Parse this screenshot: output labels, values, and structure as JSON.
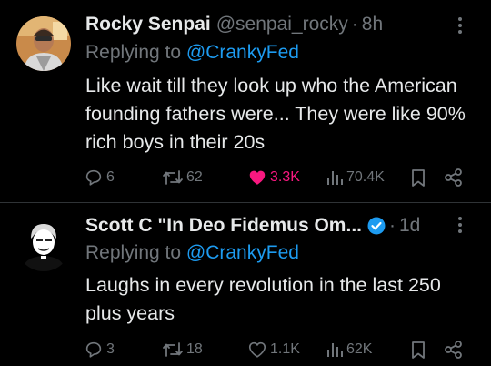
{
  "tweets": [
    {
      "name": "Rocky Senpai",
      "handle": "@senpai_rocky",
      "separator": "·",
      "time": "8h",
      "replying_prefix": "Replying to",
      "replying_to": "@CrankyFed",
      "text": "Like wait till they look up who the American founding fathers were... They were like 90% rich boys in their 20s",
      "replies": "6",
      "retweets": "62",
      "likes": "3.3K",
      "views": "70.4K",
      "liked": true
    },
    {
      "name": "Scott C \"In Deo Fidemus Om...",
      "handle": "",
      "separator": "·",
      "time": "1d",
      "replying_prefix": "Replying to",
      "replying_to": "@CrankyFed",
      "text": "Laughs in every revolution in the last 250 plus years",
      "replies": "3",
      "retweets": "18",
      "likes": "1.1K",
      "views": "62K",
      "liked": false,
      "verified": true
    }
  ],
  "colors": {
    "background": "#000000",
    "text": "#e7e9ea",
    "muted": "#71767b",
    "link": "#1d9bf0",
    "like_active": "#f91880",
    "divider": "#2f3336"
  },
  "icons": [
    "more-icon",
    "reply-icon",
    "retweet-icon",
    "heart-icon",
    "views-icon",
    "bookmark-icon",
    "share-icon",
    "verified-icon"
  ]
}
